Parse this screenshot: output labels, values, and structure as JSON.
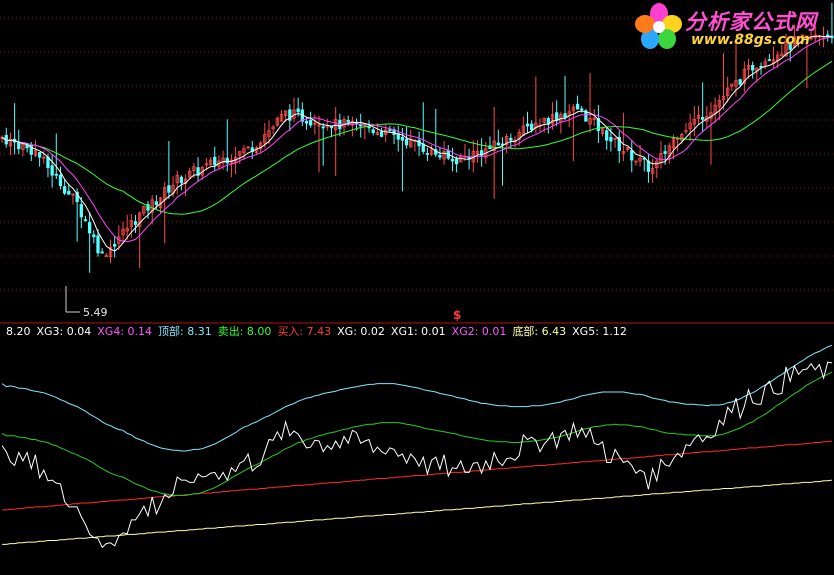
{
  "colors": {
    "background": "#000000",
    "up": "#ff4a4a",
    "down": "#54ffff",
    "grid": "#7a1414",
    "divider": "#b01515",
    "price_ma_short": "#ffffff",
    "price_ma_mid": "#ff44ff",
    "price_ma_long": "#33ff33",
    "top_band": "#7fe8ff",
    "sell_band": "#22cc22",
    "buy_band": "#ff2a2a",
    "bottom_band": "#ffffa0",
    "osc": "#ffffff"
  },
  "price_panel": {
    "min_label": "5.49",
    "marker": "$"
  },
  "indicator_legend": [
    {
      "text": "8.20",
      "color": "#ffffff"
    },
    {
      "text": "XG3: 0.04",
      "color": "#ffffff"
    },
    {
      "text": "XG4: 0.14",
      "color": "#ff55ff"
    },
    {
      "text": "顶部: 8.31",
      "color": "#7fe8ff"
    },
    {
      "text": "卖出: 8.00",
      "color": "#33ff33"
    },
    {
      "text": "买入: 7.43",
      "color": "#ff3a3a"
    },
    {
      "text": "XG: 0.02",
      "color": "#ffffff"
    },
    {
      "text": "XG1: 0.01",
      "color": "#ffffff"
    },
    {
      "text": "XG2: 0.01",
      "color": "#ff55ff"
    },
    {
      "text": "底部: 6.43",
      "color": "#ffffa0"
    },
    {
      "text": "XG5: 1.12",
      "color": "#ffffff"
    }
  ],
  "watermark": {
    "line1": "分析家公式网",
    "line2": "www.88gs.com"
  },
  "chart_data": {
    "type": "candlestick",
    "ohlc": [],
    "indicator": {
      "osc": [],
      "top": [],
      "sell": [],
      "buy": [],
      "bottom": []
    }
  }
}
